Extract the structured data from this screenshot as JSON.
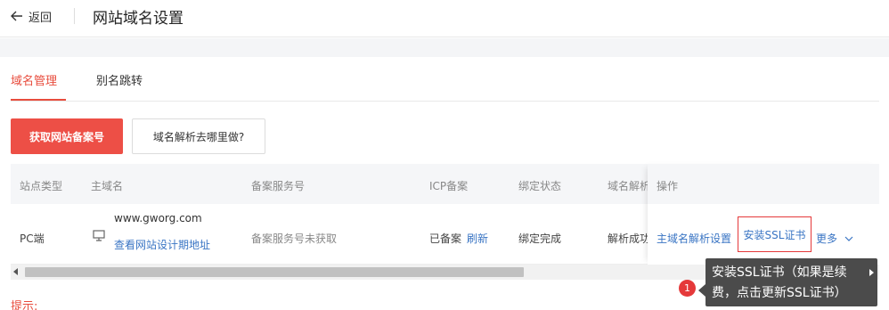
{
  "header": {
    "back_label": "返回",
    "title": "网站域名设置"
  },
  "tabs": [
    {
      "label": "域名管理",
      "active": true
    },
    {
      "label": "别名跳转",
      "active": false
    }
  ],
  "actions": {
    "primary_label": "获取网站备案号",
    "secondary_label": "域名解析去哪里做?"
  },
  "table": {
    "columns": [
      "站点类型",
      "主域名",
      "备案服务号",
      "ICP备案",
      "绑定状态",
      "域名解析",
      "操作"
    ],
    "row": {
      "site_type": "PC端",
      "domain": "www.gworg.com",
      "domain_link": "查看网站设计期地址",
      "service_number": "备案服务号未获取",
      "icp_status": "已备案",
      "icp_refresh": "刷新",
      "bind_status": "绑定完成",
      "dns_status": "解析成功",
      "ops": {
        "dns_setup": "主域名解析设置",
        "install_ssl": "安装SSL证书",
        "more": "更多"
      }
    }
  },
  "tip_label": "提示:",
  "callout": {
    "badge": "1",
    "line1": "安装SSL证书（如果是续",
    "line2": "费，点击更新SSL证书）"
  },
  "colors": {
    "accent": "#e84c3d",
    "primary_button": "#ed4f46",
    "link": "#3a75c4",
    "callout_bg": "#4b4b4b"
  },
  "icons": [
    "arrow-left-icon",
    "monitor-icon",
    "chevron-down-icon",
    "scroll-left-arrow-icon",
    "callout-expand-icon"
  ]
}
